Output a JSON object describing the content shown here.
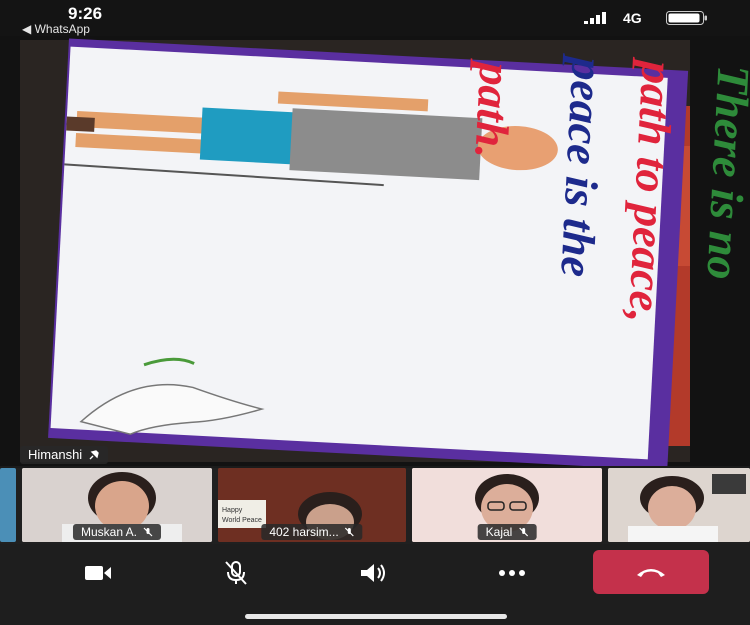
{
  "status_bar": {
    "time": "9:26",
    "back_label": "◀ WhatsApp",
    "network": "4G",
    "icons": [
      "signal-icon",
      "battery-icon"
    ]
  },
  "main_video": {
    "participant_name": "Himanshi",
    "pinned_icon": "pin-icon",
    "poster_lines": [
      "There is no",
      "path to peace,",
      "peace is the",
      "path."
    ],
    "poster_colors": {
      "green": "#2e8b3a",
      "red": "#e0243c",
      "navy": "#1d2a8c",
      "border": "#5a2fa0"
    }
  },
  "participants": [
    {
      "name": "Muskan A.",
      "muted": true
    },
    {
      "name": "402 harsim...",
      "muted": true,
      "poster_text": "Happy World Peace"
    },
    {
      "name": "Kajal",
      "muted": true
    },
    {
      "name": "",
      "muted": false
    }
  ],
  "controls": {
    "camera_icon": "camera-icon",
    "mic_icon": "mic-off-icon",
    "speaker_icon": "speaker-icon",
    "more_icon": "more-icon",
    "hangup_icon": "hangup-icon",
    "hangup_color": "#c4314b"
  }
}
